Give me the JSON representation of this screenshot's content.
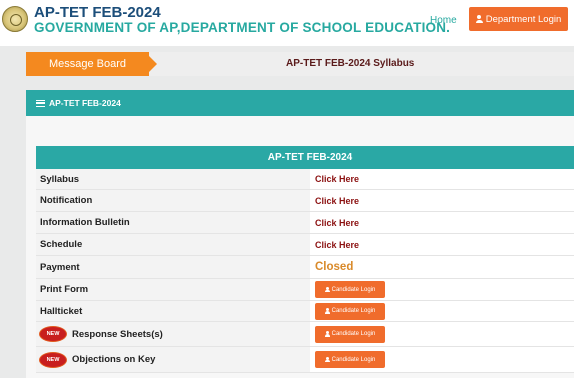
{
  "header": {
    "title": "AP-TET FEB-2024",
    "subtitle": "GOVERNMENT OF AP,DEPARTMENT OF SCHOOL EDUCATION.",
    "home_label": "Home",
    "department_login_label": "Department Login"
  },
  "message_board": {
    "tab_label": "Message Board",
    "ticker_text": "AP-TET FEB-2024 Syllabus"
  },
  "panel": {
    "heading": "AP-TET FEB-2024",
    "table_title": "AP-TET FEB-2024",
    "new_badge": "NEW",
    "rows": [
      {
        "label": "Syllabus",
        "value": "Click Here",
        "kind": "link"
      },
      {
        "label": "Notification",
        "value": "Click Here",
        "kind": "link"
      },
      {
        "label": "Information Bulletin",
        "value": "Click Here",
        "kind": "link"
      },
      {
        "label": "Schedule",
        "value": "Click Here",
        "kind": "link"
      },
      {
        "label": "Payment",
        "value": "Closed",
        "kind": "status"
      },
      {
        "label": "Print Form",
        "value": "Candidate Login",
        "kind": "button"
      },
      {
        "label": "Hallticket",
        "value": "Candidate Login",
        "kind": "button"
      },
      {
        "label": "Response Sheets(s)",
        "value": "Candidate Login",
        "kind": "button",
        "is_new": true
      },
      {
        "label": "Objections on Key",
        "value": "Candidate Login",
        "kind": "button",
        "is_new": true
      }
    ]
  },
  "colors": {
    "accent_teal": "#2aa8a5",
    "accent_orange": "#f06c2c",
    "title_blue": "#1c4e7a",
    "link_red": "#8b1010",
    "closed_orange": "#d98a2a"
  }
}
